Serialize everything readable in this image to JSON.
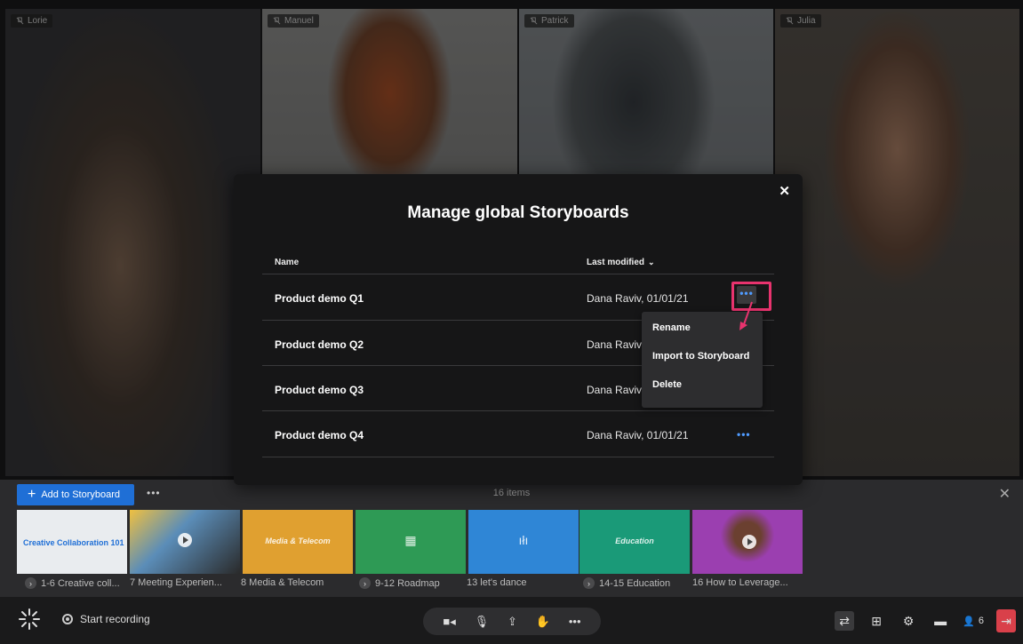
{
  "video_tiles": [
    {
      "name": "Lorie"
    },
    {
      "name": "Manuel"
    },
    {
      "name": "Patrick"
    },
    {
      "name": "Julia"
    }
  ],
  "modal": {
    "title": "Manage global Storyboards",
    "close_icon": "close-icon",
    "columns": {
      "name": "Name",
      "last_modified": "Last modified"
    },
    "rows": [
      {
        "name": "Product demo Q1",
        "modified": "Dana Raviv, 01/01/21"
      },
      {
        "name": "Product demo Q2",
        "modified": "Dana Raviv,"
      },
      {
        "name": "Product demo Q3",
        "modified": "Dana Raviv,"
      },
      {
        "name": "Product demo Q4",
        "modified": "Dana Raviv, 01/01/21"
      }
    ],
    "more_label": "•••",
    "menu": {
      "items": [
        "Rename",
        "Import to Storyboard",
        "Delete"
      ]
    },
    "highlight_color": "#e8336e"
  },
  "storyboard": {
    "add_label": "Add to Storyboard",
    "more_label": "•••",
    "count": "16 items",
    "thumbnails": [
      {
        "caption": "1-6 Creative coll...",
        "color": "#e9ecef",
        "text": "Creative Collaboration 101",
        "chevron": true
      },
      {
        "caption": "7 Meeting Experien...",
        "color": "#5b8db8",
        "text": "",
        "chevron": false
      },
      {
        "caption": "8 Media & Telecom",
        "color": "#e0a030",
        "text": "Media & Telecom",
        "chevron": false
      },
      {
        "caption": "9-12 Roadmap",
        "color": "#2e9a55",
        "text": "",
        "chevron": true
      },
      {
        "caption": "13 let's dance",
        "color": "#2f86d6",
        "text": "",
        "chevron": false
      },
      {
        "caption": "14-15 Education",
        "color": "#1a9a78",
        "text": "Education",
        "chevron": true
      },
      {
        "caption": "16 How to Leverage...",
        "color": "#9b3fb0",
        "text": "",
        "chevron": false
      }
    ]
  },
  "toolbar": {
    "record_label": "Start recording",
    "participant_count": "6",
    "accent_leave": "#d9404a",
    "accent_primary": "#1f6fd6"
  }
}
